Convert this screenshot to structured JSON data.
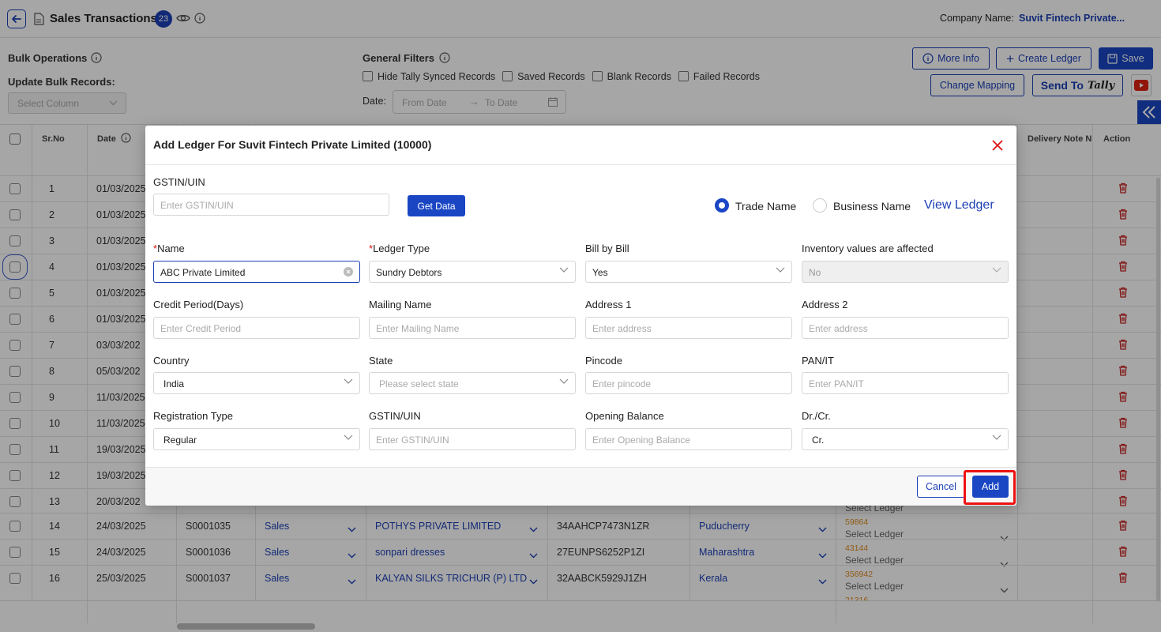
{
  "header": {
    "title": "Sales Transactions",
    "count": "23",
    "company_label": "Company Name:",
    "company_value": "Suvit Fintech Private..."
  },
  "bulk": {
    "title": "Bulk Operations",
    "update_label": "Update Bulk Records:",
    "select_placeholder": "Select Column"
  },
  "filters": {
    "title": "General Filters",
    "options": [
      "Hide Tally Synced Records",
      "Saved Records",
      "Blank Records",
      "Failed Records"
    ],
    "date_label": "Date:",
    "from_placeholder": "From Date",
    "to_placeholder": "To Date"
  },
  "actions": {
    "more_info": "More Info",
    "create_ledger": "Create Ledger",
    "save": "Save",
    "change_mapping": "Change Mapping",
    "send_to": "Send To",
    "tally_logo": "Tally"
  },
  "table": {
    "headers": {
      "srno": "Sr.No",
      "date": "Date",
      "delivery": "Delivery Note N",
      "action": "Action"
    },
    "rows": [
      {
        "sr": "1",
        "date": "01/03/2025"
      },
      {
        "sr": "2",
        "date": "01/03/2025"
      },
      {
        "sr": "3",
        "date": "01/03/2025"
      },
      {
        "sr": "4",
        "date": "01/03/2025"
      },
      {
        "sr": "5",
        "date": "01/03/2025"
      },
      {
        "sr": "6",
        "date": "01/03/2025"
      },
      {
        "sr": "7",
        "date": "03/03/202"
      },
      {
        "sr": "8",
        "date": "05/03/202"
      },
      {
        "sr": "9",
        "date": "11/03/2025"
      },
      {
        "sr": "10",
        "date": "11/03/2025"
      },
      {
        "sr": "11",
        "date": "19/03/2025"
      },
      {
        "sr": "12",
        "date": "19/03/2025"
      },
      {
        "sr": "13",
        "date": "20/03/202"
      },
      {
        "sr": "14",
        "date": "24/03/2025",
        "voucher": "S0001035",
        "type": "Sales",
        "party": "POTHYS PRIVATE LIMITED",
        "gstin": "34AAHCP7473N1ZR",
        "state": "Puducherry",
        "amount": "59864",
        "ledger": "Select Ledger"
      },
      {
        "sr": "15",
        "date": "24/03/2025",
        "voucher": "S0001036",
        "type": "Sales",
        "party": "sonpari dresses",
        "gstin": "27EUNPS6252P1ZI",
        "state": "Maharashtra",
        "amount": "43144",
        "ledger": "Select Ledger"
      },
      {
        "sr": "16",
        "date": "25/03/2025",
        "voucher": "S0001037",
        "type": "Sales",
        "party": "KALYAN SILKS TRICHUR (P) LTD",
        "gstin": "32AABCK5929J1ZH",
        "state": "Kerala",
        "amount": "356942",
        "ledger": "Select Ledger"
      }
    ],
    "row13_ledger": "Select Ledger",
    "row17_amount": "21316"
  },
  "modal": {
    "title": "Add Ledger For  Suvit Fintech Private Limited (10000)",
    "gstin_label": "GSTIN/UIN",
    "gstin_placeholder": "Enter GSTIN/UIN",
    "get_data": "Get Data",
    "trade_name": "Trade Name",
    "business_name": "Business Name",
    "view_ledger": "View Ledger",
    "name_label": "Name",
    "name_value": "ABC Private Limited",
    "ledger_type_label": "Ledger Type",
    "ledger_type_value": "Sundry Debtors",
    "bill_label": "Bill by Bill",
    "bill_value": "Yes",
    "inventory_label": "Inventory values are affected",
    "inventory_value": "No",
    "credit_label": "Credit Period(Days)",
    "credit_placeholder": "Enter Credit Period",
    "mailing_label": "Mailing Name",
    "mailing_placeholder": "Enter Mailing Name",
    "addr1_label": "Address 1",
    "addr1_placeholder": "Enter address",
    "addr2_label": "Address 2",
    "addr2_placeholder": "Enter address",
    "country_label": "Country",
    "country_value": "India",
    "state_label": "State",
    "state_placeholder": "Please select state",
    "pincode_label": "Pincode",
    "pincode_placeholder": "Enter pincode",
    "pan_label": "PAN/IT",
    "pan_placeholder": "Enter PAN/IT",
    "regtype_label": "Registration Type",
    "regtype_value": "Regular",
    "gstin2_label": "GSTIN/UIN",
    "gstin2_placeholder": "Enter GSTIN/UIN",
    "opening_label": "Opening Balance",
    "opening_placeholder": "Enter Opening Balance",
    "drcr_label": "Dr./Cr.",
    "drcr_value": "Cr.",
    "cancel": "Cancel",
    "add": "Add"
  },
  "colors": {
    "primary": "#1a46c4",
    "danger": "#e11111",
    "amount": "#e08a1e"
  }
}
